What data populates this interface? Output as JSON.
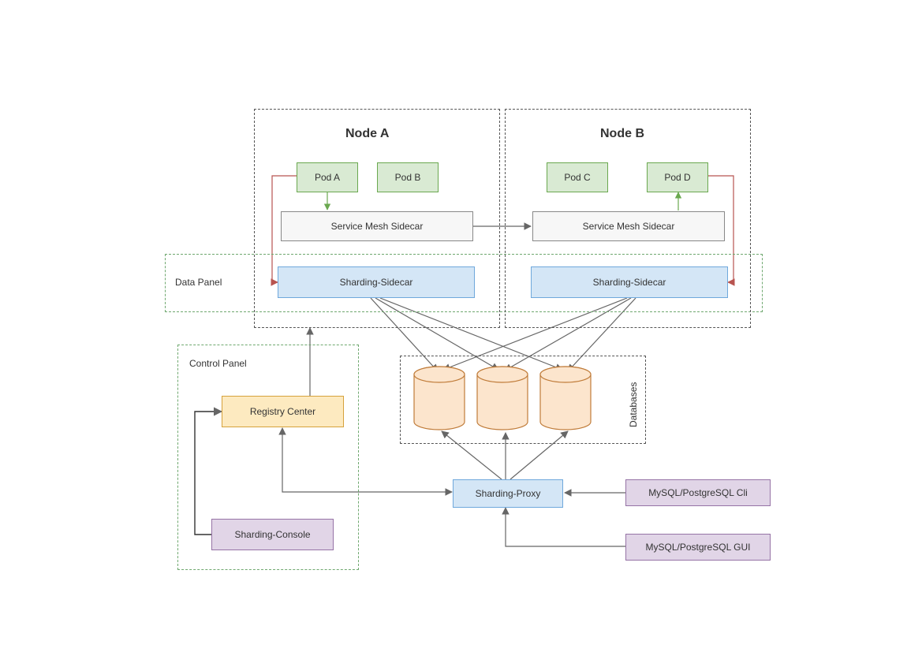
{
  "nodeA": {
    "title": "Node A",
    "podA": "Pod A",
    "podB": "Pod B",
    "mesh": "Service Mesh Sidecar",
    "sidecar": "Sharding-Sidecar"
  },
  "nodeB": {
    "title": "Node B",
    "podC": "Pod C",
    "podD": "Pod D",
    "mesh": "Service Mesh Sidecar",
    "sidecar": "Sharding-Sidecar"
  },
  "panels": {
    "data": "Data Panel",
    "control": "Control Panel",
    "databases": "Databases"
  },
  "control": {
    "registry": "Registry Center",
    "console": "Sharding-Console"
  },
  "proxy": "Sharding-Proxy",
  "clients": {
    "cli": "MySQL/PostgreSQL Cli",
    "gui": "MySQL/PostgreSQL GUI"
  }
}
